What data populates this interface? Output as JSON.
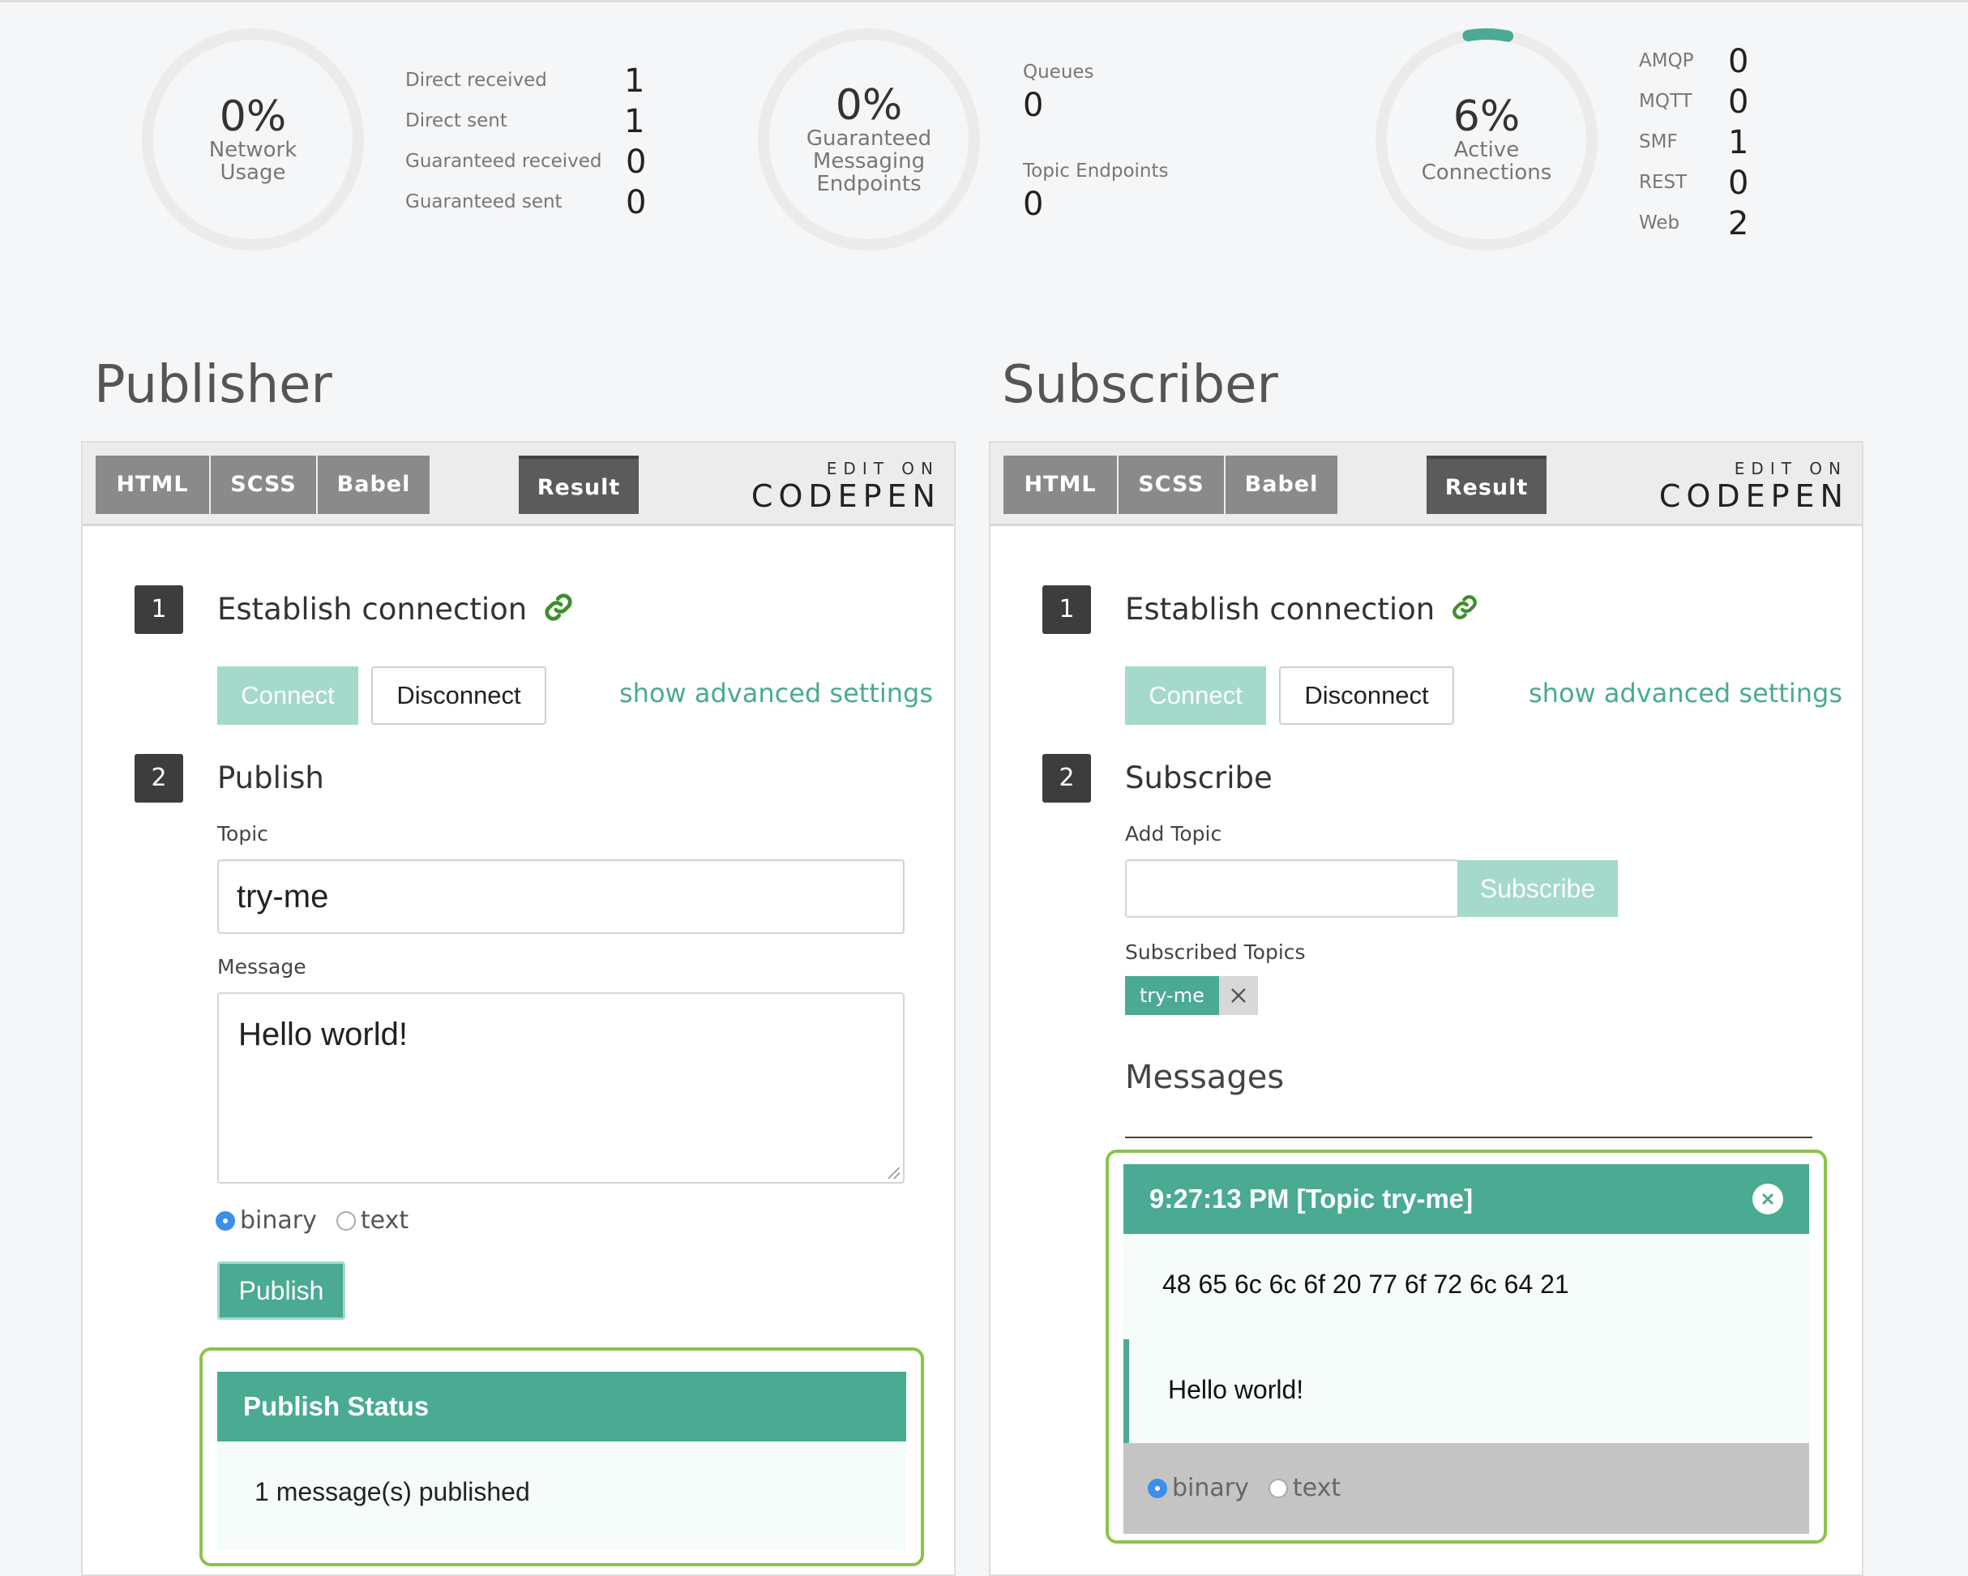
{
  "stats": {
    "network": {
      "percent": "0%",
      "label": "Network\nUsage",
      "fill": 0.0
    },
    "direct_guaranteed": [
      {
        "label": "Direct received",
        "value": "1"
      },
      {
        "label": "Direct sent",
        "value": "1"
      },
      {
        "label": "Guaranteed received",
        "value": "0"
      },
      {
        "label": "Guaranteed sent",
        "value": "0"
      }
    ],
    "endpoints": {
      "percent": "0%",
      "label": "Guaranteed\nMessaging\nEndpoints",
      "fill": 0.0
    },
    "queues": {
      "label": "Queues",
      "value": "0"
    },
    "topic_endpoints": {
      "label": "Topic Endpoints",
      "value": "0"
    },
    "connections": {
      "percent": "6%",
      "label": "Active\nConnections",
      "fill": 0.06
    },
    "protocols": [
      {
        "label": "AMQP",
        "value": "0"
      },
      {
        "label": "MQTT",
        "value": "0"
      },
      {
        "label": "SMF",
        "value": "1"
      },
      {
        "label": "REST",
        "value": "0"
      },
      {
        "label": "Web",
        "value": "2"
      }
    ]
  },
  "colors": {
    "accent": "#4aaa92",
    "accent_light": "#a4d9cb",
    "highlight": "#8bc34a",
    "gauge_track": "#ebebeb"
  },
  "codepen": {
    "tabs": [
      "HTML",
      "SCSS",
      "Babel"
    ],
    "result": "Result",
    "edit_on": "EDIT ON",
    "logo": "CODEPEN"
  },
  "publisher": {
    "title": "Publisher",
    "step1": {
      "num": "1",
      "title": "Establish connection",
      "icon": "link-icon"
    },
    "connect": "Connect",
    "disconnect": "Disconnect",
    "advanced": "show advanced settings",
    "step2": {
      "num": "2",
      "title": "Publish"
    },
    "topic_label": "Topic",
    "topic_value": "try-me",
    "message_label": "Message",
    "message_value": "Hello world!",
    "format": {
      "binary": "binary",
      "text": "text",
      "selected": "binary"
    },
    "publish": "Publish",
    "status": {
      "title": "Publish Status",
      "body": "1 message(s) published"
    }
  },
  "subscriber": {
    "title": "Subscriber",
    "step1": {
      "num": "1",
      "title": "Establish connection",
      "icon": "link-icon"
    },
    "connect": "Connect",
    "disconnect": "Disconnect",
    "advanced": "show advanced settings",
    "step2": {
      "num": "2",
      "title": "Subscribe"
    },
    "add_topic_label": "Add Topic",
    "add_topic_value": "",
    "subscribe": "Subscribe",
    "subscribed_label": "Subscribed Topics",
    "subscribed_topics": [
      "try-me"
    ],
    "messages_title": "Messages",
    "message": {
      "header": "9:27:13 PM [Topic try-me]",
      "hex": "48 65 6c 6c 6f 20 77 6f 72 6c 64 21",
      "text": "Hello world!",
      "format": {
        "binary": "binary",
        "text": "text",
        "selected": "binary"
      }
    }
  }
}
